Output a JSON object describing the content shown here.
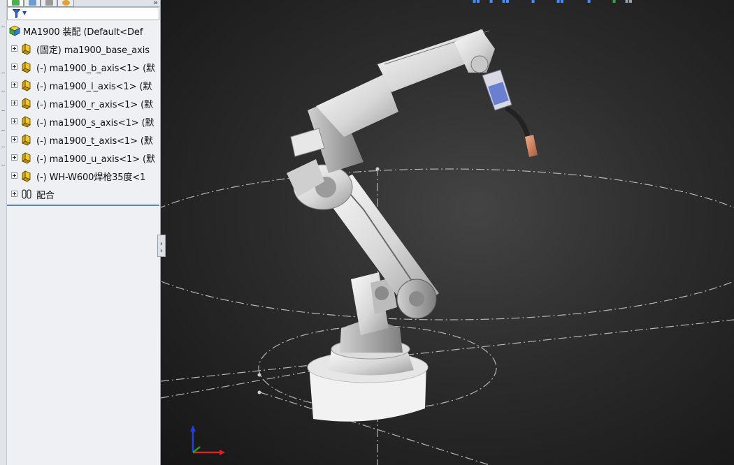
{
  "panel": {
    "tabs": [
      {
        "icon": "feature-manager-icon",
        "color": "#2a7a2a"
      },
      {
        "icon": "property-manager-icon",
        "color": "#3a6ea8"
      },
      {
        "icon": "configuration-manager-icon",
        "color": "#7a7a7a"
      },
      {
        "icon": "display-manager-icon",
        "color": "#d08a1a"
      }
    ],
    "filter_icon": "filter-icon"
  },
  "tree": {
    "root": {
      "label": "MA1900 装配  (Default<Def",
      "icon": "assembly-icon"
    },
    "items": [
      {
        "label": "(固定) ma1900_base_axis",
        "icon": "part-icon"
      },
      {
        "label": "(-) ma1900_b_axis<1> (默",
        "icon": "part-icon"
      },
      {
        "label": "(-) ma1900_l_axis<1> (默",
        "icon": "part-icon"
      },
      {
        "label": "(-) ma1900_r_axis<1> (默",
        "icon": "part-icon"
      },
      {
        "label": "(-) ma1900_s_axis<1> (默",
        "icon": "part-icon"
      },
      {
        "label": "(-) ma1900_t_axis<1> (默",
        "icon": "part-icon"
      },
      {
        "label": "(-) ma1900_u_axis<1> (默",
        "icon": "part-icon"
      },
      {
        "label": "(-) WH-W600焊枪35度<1",
        "icon": "part-icon"
      },
      {
        "label": "配合",
        "icon": "mates-icon"
      }
    ]
  },
  "viewport": {
    "background": "#2c2c2c",
    "model": "industrial-robot-arm-with-welding-torch",
    "triad_icon": "coordinate-triad-icon"
  },
  "colors": {
    "accent": "#4f86c6",
    "part_yellow": "#e0b21a",
    "triad_x": "#e02020",
    "triad_y": "#20a020",
    "triad_z": "#2040e0"
  }
}
